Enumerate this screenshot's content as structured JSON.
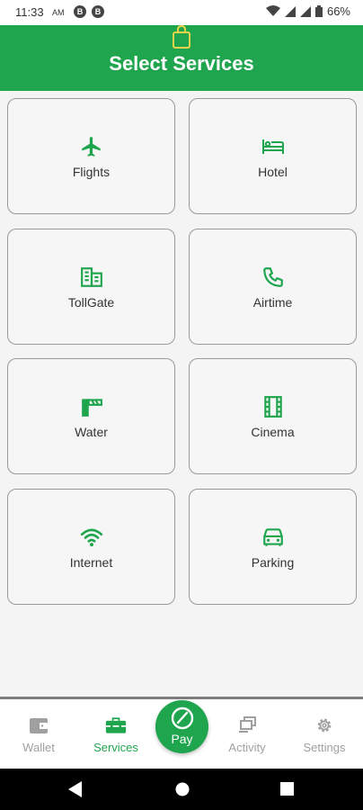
{
  "status_bar": {
    "time": "11:33",
    "ampm": "AM",
    "badges": [
      "B",
      "B"
    ],
    "battery": "66%"
  },
  "header": {
    "title": "Select Services",
    "icon": "shopping-bag-icon"
  },
  "services": [
    {
      "label": "Flights",
      "icon": "airplane-icon"
    },
    {
      "label": "Hotel",
      "icon": "hotel-bed-icon"
    },
    {
      "label": "TollGate",
      "icon": "toll-building-icon"
    },
    {
      "label": "Airtime",
      "icon": "phone-icon"
    },
    {
      "label": "Water",
      "icon": "water-tap-icon"
    },
    {
      "label": "Cinema",
      "icon": "film-icon"
    },
    {
      "label": "Internet",
      "icon": "wifi-icon"
    },
    {
      "label": "Parking",
      "icon": "car-icon"
    }
  ],
  "bottom_nav": {
    "items": [
      {
        "label": "Wallet",
        "icon": "wallet-icon"
      },
      {
        "label": "Services",
        "icon": "toolbox-icon",
        "active": true
      },
      {
        "label": "Activity",
        "icon": "activity-icon"
      },
      {
        "label": "Settings",
        "icon": "gear-icon"
      }
    ],
    "pay_label": "Pay"
  },
  "colors": {
    "primary": "#1fa54e",
    "inactive": "#a0a0a0"
  }
}
